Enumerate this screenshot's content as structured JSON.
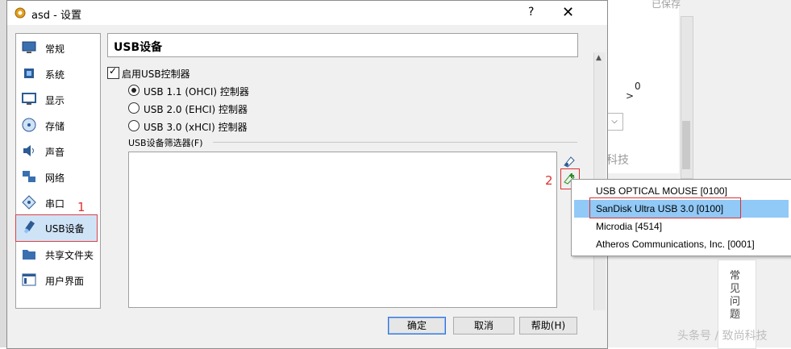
{
  "background": {
    "saved_label": "已保存",
    "select_arrow": "⌵",
    "gt": ">",
    "paren": "0",
    "kejiji": "科技",
    "faq": "常见问题",
    "watermark": "头条号 / 致尚科技"
  },
  "window": {
    "title": "asd - 设置",
    "help": "?",
    "close": "✕"
  },
  "sidebar": {
    "items": [
      {
        "label": "常规",
        "icon": "general-monitor-icon"
      },
      {
        "label": "系统",
        "icon": "system-chip-icon"
      },
      {
        "label": "显示",
        "icon": "display-monitor-icon"
      },
      {
        "label": "存储",
        "icon": "storage-disk-icon"
      },
      {
        "label": "声音",
        "icon": "speaker-icon"
      },
      {
        "label": "网络",
        "icon": "network-icon"
      },
      {
        "label": "串口",
        "icon": "serial-port-icon"
      },
      {
        "label": "USB设备",
        "icon": "usb-icon"
      },
      {
        "label": "共享文件夹",
        "icon": "folder-icon"
      },
      {
        "label": "用户界面",
        "icon": "user-interface-icon"
      }
    ],
    "selected_index": 7
  },
  "main": {
    "section_title": "USB设备",
    "enable_usb_label": "启用USB控制器",
    "enable_usb_checked": true,
    "controllers": [
      {
        "label": "USB 1.1 (OHCI) 控制器",
        "selected": true
      },
      {
        "label": "USB 2.0 (EHCI) 控制器",
        "selected": false
      },
      {
        "label": "USB 3.0 (xHCI) 控制器",
        "selected": false
      }
    ],
    "filters_label": "USB设备筛选器(F)"
  },
  "buttons": {
    "ok": "确定",
    "cancel": "取消",
    "help": "帮助(H)"
  },
  "annotations": {
    "one": "1",
    "two": "2",
    "three": "3"
  },
  "menu": {
    "items": [
      "USB OPTICAL MOUSE [0100]",
      "SanDisk Ultra USB 3.0 [0100]",
      "Microdia  [4514]",
      "Atheros Communications, Inc. [0001]"
    ],
    "highlighted_index": 1
  },
  "colors": {
    "selection": "#cfe3f7",
    "menu_highlight": "#91c9f7",
    "annotation": "#e03030"
  }
}
